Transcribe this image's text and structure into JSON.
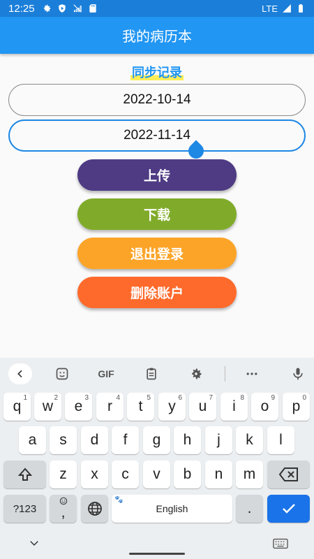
{
  "status_bar": {
    "time": "12:25",
    "network": "LTE",
    "icons": [
      "gear-icon",
      "shield-play-icon",
      "no-signal-icon",
      "sd-card-icon",
      "signal-icon",
      "battery-icon"
    ]
  },
  "app_bar": {
    "title": "我的病历本"
  },
  "sync": {
    "title": "同步记录",
    "start_date": "2022-10-14",
    "end_date": "2022-11-14"
  },
  "buttons": {
    "upload": "上传",
    "download": "下载",
    "logout": "退出登录",
    "delete_account": "删除账户"
  },
  "colors": {
    "status_bar": "#1b7fd9",
    "app_bar": "#2196f3",
    "upload": "#4e3b83",
    "download": "#80ab2a",
    "logout": "#fca428",
    "delete_account": "#fe6a2c",
    "focus": "#1e88e5"
  },
  "keyboard": {
    "toolbar": {
      "gif": "GIF"
    },
    "row1": [
      {
        "k": "q",
        "h": "1"
      },
      {
        "k": "w",
        "h": "2"
      },
      {
        "k": "e",
        "h": "3"
      },
      {
        "k": "r",
        "h": "4"
      },
      {
        "k": "t",
        "h": "5"
      },
      {
        "k": "y",
        "h": "6"
      },
      {
        "k": "u",
        "h": "7"
      },
      {
        "k": "i",
        "h": "8"
      },
      {
        "k": "o",
        "h": "9"
      },
      {
        "k": "p",
        "h": "0"
      }
    ],
    "row2": [
      "a",
      "s",
      "d",
      "f",
      "g",
      "h",
      "j",
      "k",
      "l"
    ],
    "row3": [
      "z",
      "x",
      "c",
      "v",
      "b",
      "n",
      "m"
    ],
    "symbols": "?123",
    "comma": ",",
    "space": "English",
    "period": "."
  }
}
